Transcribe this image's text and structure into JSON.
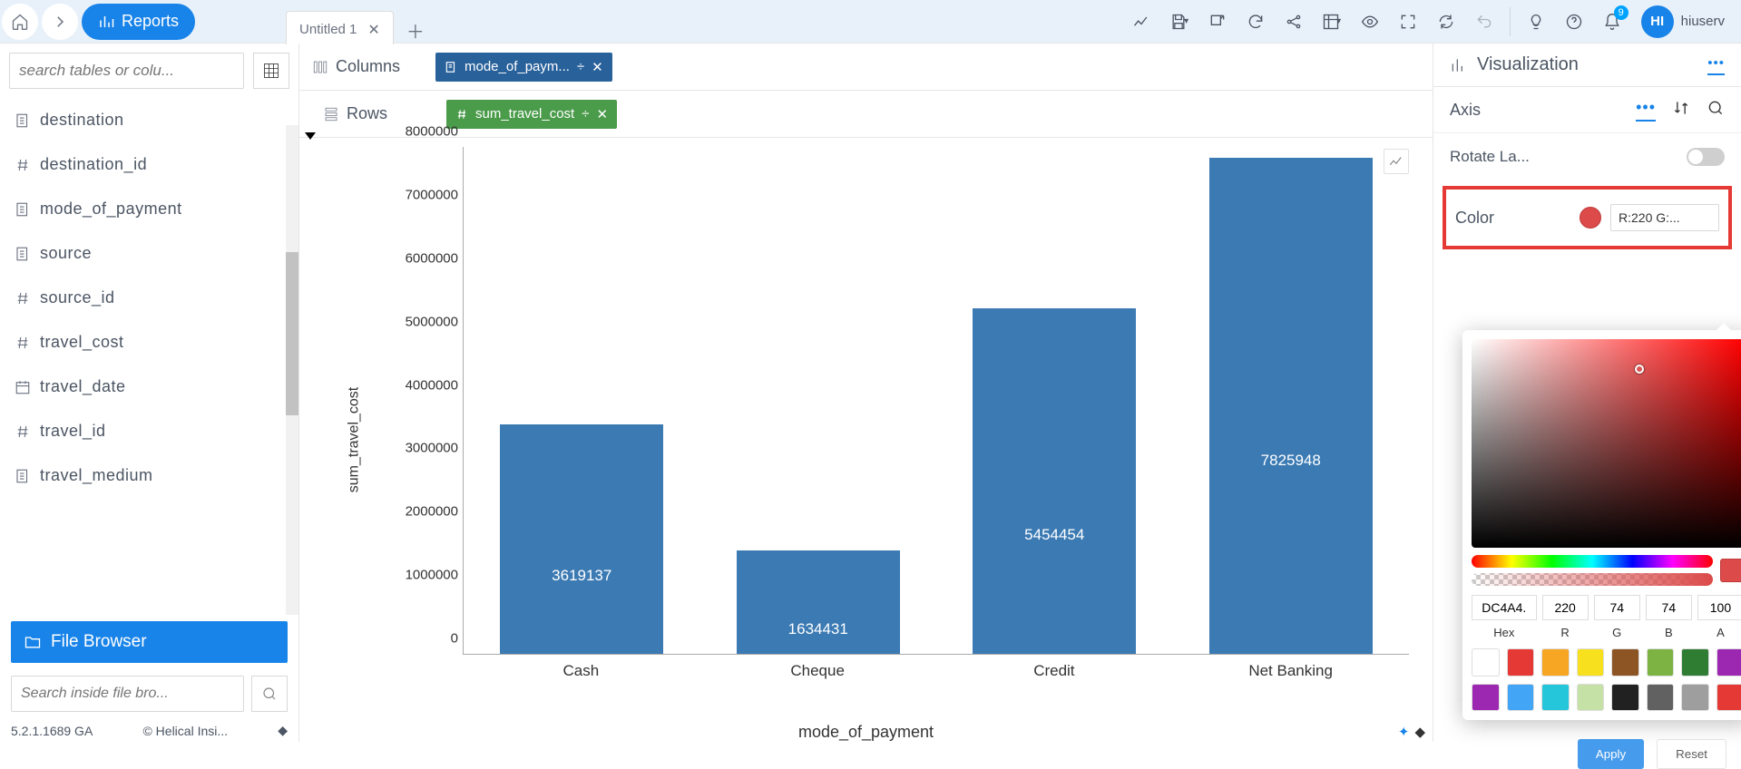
{
  "header": {
    "reports_label": "Reports",
    "tab_title": "Untitled 1",
    "notification_count": "9",
    "avatar_initials": "HI",
    "username": "hiuserv"
  },
  "sidebar": {
    "search_placeholder": "search tables or colu...",
    "columns": [
      {
        "icon": "text",
        "name": "destination"
      },
      {
        "icon": "hash",
        "name": "destination_id"
      },
      {
        "icon": "text",
        "name": "mode_of_payment"
      },
      {
        "icon": "text",
        "name": "source"
      },
      {
        "icon": "hash",
        "name": "source_id"
      },
      {
        "icon": "hash",
        "name": "travel_cost"
      },
      {
        "icon": "date",
        "name": "travel_date"
      },
      {
        "icon": "hash",
        "name": "travel_id"
      },
      {
        "icon": "text",
        "name": "travel_medium"
      }
    ],
    "file_browser_label": "File Browser",
    "file_search_placeholder": "Search inside file bro...",
    "version": "5.2.1.1689 GA",
    "copyright": "© Helical Insi..."
  },
  "shelves": {
    "columns_label": "Columns",
    "columns_chip": "mode_of_paym...",
    "rows_label": "Rows",
    "rows_chip": "sum_travel_cost"
  },
  "chart_data": {
    "type": "bar",
    "categories": [
      "Cash",
      "Cheque",
      "Credit",
      "Net Banking"
    ],
    "values": [
      3619137,
      1634431,
      5454454,
      7825948
    ],
    "data_labels": [
      "3619137",
      "1634431",
      "5454454",
      "7825948"
    ],
    "xlabel": "mode_of_payment",
    "ylabel": "sum_travel_cost",
    "ylim": [
      0,
      8000000
    ],
    "y_ticks": [
      "0",
      "1000000",
      "2000000",
      "3000000",
      "4000000",
      "5000000",
      "6000000",
      "7000000",
      "8000000"
    ]
  },
  "viz_panel": {
    "title": "Visualization",
    "axis_label": "Axis",
    "rotate_label": "Rotate La...",
    "color_label": "Color",
    "color_value_text": "R:220 G:...",
    "picker": {
      "hex": "DC4A4.",
      "r": "220",
      "g": "74",
      "b": "74",
      "a": "100",
      "hex_label": "Hex",
      "r_label": "R",
      "g_label": "G",
      "b_label": "B",
      "a_label": "A",
      "presets": [
        "#ffffff",
        "#e53935",
        "#f6a623",
        "#f7e01e",
        "#8d5524",
        "#7cb342",
        "#2e7d32",
        "#9c27b0",
        "#9c27b0",
        "#42a5f5",
        "#26c6da",
        "#c5e1a5",
        "#212121",
        "#616161",
        "#9e9e9e",
        "#e53935"
      ]
    },
    "apply_label": "Apply",
    "reset_label": "Reset"
  }
}
